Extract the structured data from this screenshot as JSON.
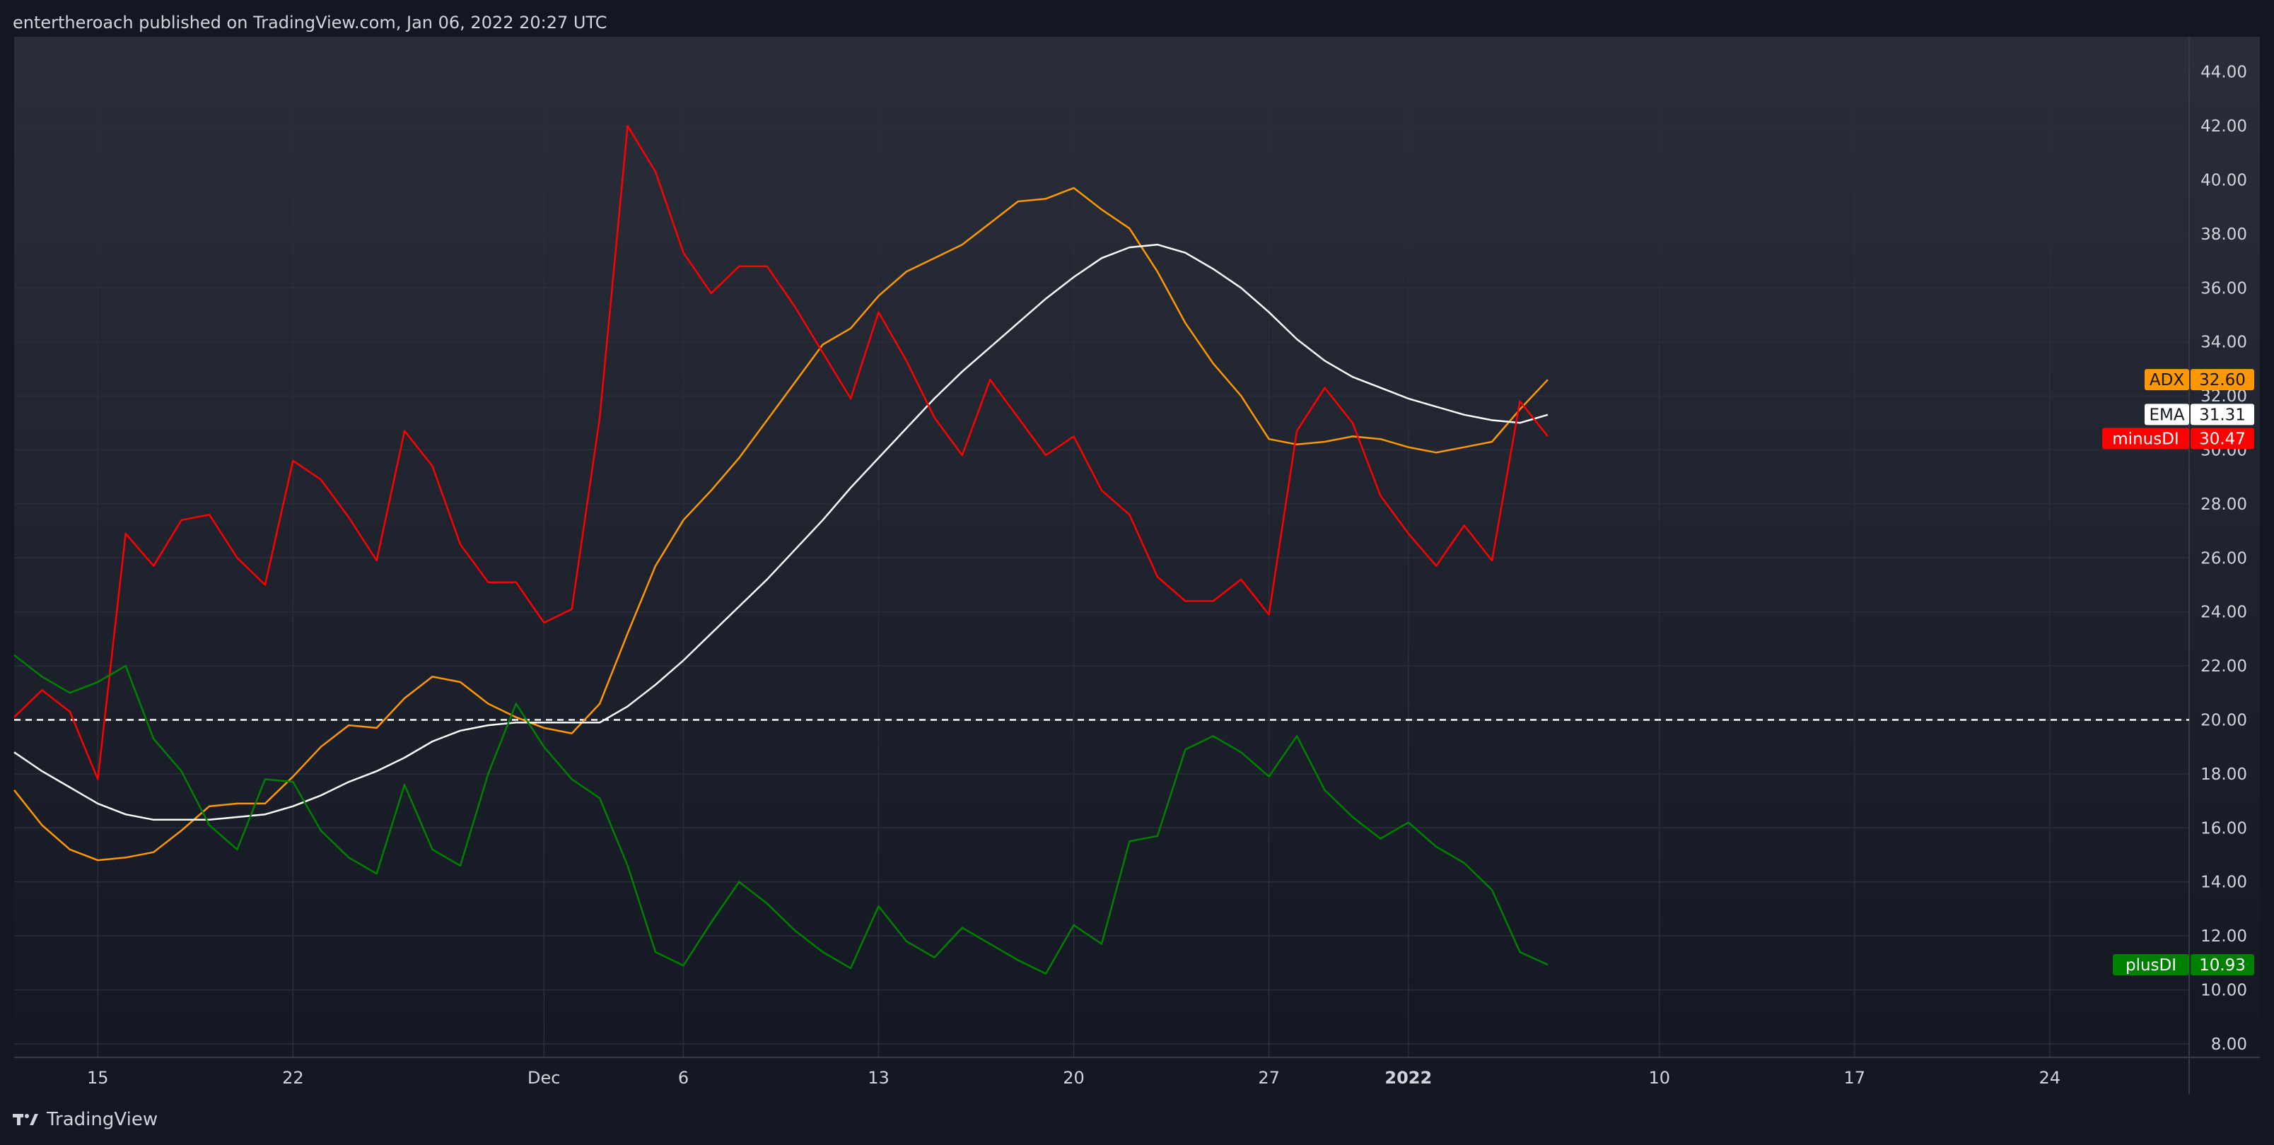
{
  "header": {
    "published_text": "entertheroach published on TradingView.com, Jan 06, 2022 20:27 UTC"
  },
  "footer": {
    "brand_icon": "tradingview-logo-icon",
    "brand_label": "TradingView"
  },
  "colors": {
    "background": "#131722",
    "pane_top": "#2a2e39",
    "pane_bottom": "#131722",
    "grid": "#2a2e39",
    "text": "#d1d4dc",
    "adx": "#ff9800",
    "ema": "#ffffff",
    "minus_di": "#ff0000",
    "plus_di": "#008000"
  },
  "chart_data": {
    "type": "line",
    "title": "",
    "xlabel": "",
    "ylabel": "",
    "ylim": [
      7.5,
      45.3
    ],
    "y_ticks": [
      "8.00",
      "10.00",
      "12.00",
      "14.00",
      "16.00",
      "18.00",
      "20.00",
      "22.00",
      "24.00",
      "26.00",
      "28.00",
      "30.00",
      "32.00",
      "34.00",
      "36.00",
      "38.00",
      "40.00",
      "42.00",
      "44.00"
    ],
    "x_domain": [
      "2021-11-12",
      "2022-01-29"
    ],
    "x_ticks": [
      {
        "label": "15",
        "date": "2021-11-15",
        "bold": false
      },
      {
        "label": "22",
        "date": "2021-11-22",
        "bold": false
      },
      {
        "label": "Dec",
        "date": "2021-12-01",
        "bold": false
      },
      {
        "label": "6",
        "date": "2021-12-06",
        "bold": false
      },
      {
        "label": "13",
        "date": "2021-12-13",
        "bold": false
      },
      {
        "label": "20",
        "date": "2021-12-20",
        "bold": false
      },
      {
        "label": "27",
        "date": "2021-12-27",
        "bold": false
      },
      {
        "label": "2022",
        "date": "2022-01-01",
        "bold": true
      },
      {
        "label": "10",
        "date": "2022-01-10",
        "bold": false
      },
      {
        "label": "17",
        "date": "2022-01-17",
        "bold": false
      },
      {
        "label": "24",
        "date": "2022-01-24",
        "bold": false
      }
    ],
    "hline": {
      "value": 20.0,
      "style": "dashed",
      "color": "#ffffff"
    },
    "grid": true,
    "x": [
      "2021-11-12",
      "2021-11-13",
      "2021-11-14",
      "2021-11-15",
      "2021-11-16",
      "2021-11-17",
      "2021-11-18",
      "2021-11-19",
      "2021-11-20",
      "2021-11-21",
      "2021-11-22",
      "2021-11-23",
      "2021-11-24",
      "2021-11-25",
      "2021-11-26",
      "2021-11-27",
      "2021-11-28",
      "2021-11-29",
      "2021-11-30",
      "2021-12-01",
      "2021-12-02",
      "2021-12-03",
      "2021-12-04",
      "2021-12-05",
      "2021-12-06",
      "2021-12-07",
      "2021-12-08",
      "2021-12-09",
      "2021-12-10",
      "2021-12-11",
      "2021-12-12",
      "2021-12-13",
      "2021-12-14",
      "2021-12-15",
      "2021-12-16",
      "2021-12-17",
      "2021-12-18",
      "2021-12-19",
      "2021-12-20",
      "2021-12-21",
      "2021-12-22",
      "2021-12-23",
      "2021-12-24",
      "2021-12-25",
      "2021-12-26",
      "2021-12-27",
      "2021-12-28",
      "2021-12-29",
      "2021-12-30",
      "2021-12-31",
      "2022-01-01",
      "2022-01-02",
      "2022-01-03",
      "2022-01-04",
      "2022-01-05",
      "2022-01-06"
    ],
    "series": [
      {
        "name": "ADX",
        "color": "#ff9800",
        "last_value": "32.60",
        "values": [
          17.4,
          16.1,
          15.2,
          14.8,
          14.9,
          15.1,
          15.9,
          16.8,
          16.9,
          16.9,
          17.9,
          19.0,
          19.8,
          19.7,
          20.8,
          21.6,
          21.4,
          20.6,
          20.1,
          19.7,
          19.5,
          20.6,
          23.2,
          25.7,
          27.4,
          28.5,
          29.7,
          31.1,
          32.5,
          33.9,
          34.5,
          35.7,
          36.6,
          37.1,
          37.6,
          38.4,
          39.2,
          39.3,
          39.7,
          38.9,
          38.2,
          36.6,
          34.7,
          33.2,
          32.0,
          30.4,
          30.2,
          30.3,
          30.5,
          30.4,
          30.1,
          29.9,
          30.1,
          30.3,
          31.5,
          32.6
        ]
      },
      {
        "name": "EMA",
        "color": "#ffffff",
        "last_value": "31.31",
        "values": [
          18.8,
          18.1,
          17.5,
          16.9,
          16.5,
          16.3,
          16.3,
          16.3,
          16.4,
          16.5,
          16.8,
          17.2,
          17.7,
          18.1,
          18.6,
          19.2,
          19.6,
          19.8,
          19.9,
          19.9,
          19.9,
          19.9,
          20.5,
          21.3,
          22.2,
          23.2,
          24.2,
          25.2,
          26.3,
          27.4,
          28.6,
          29.7,
          30.8,
          31.9,
          32.9,
          33.8,
          34.7,
          35.6,
          36.4,
          37.1,
          37.5,
          37.6,
          37.3,
          36.7,
          36.0,
          35.1,
          34.1,
          33.3,
          32.7,
          32.3,
          31.9,
          31.6,
          31.3,
          31.1,
          31.0,
          31.3
        ]
      },
      {
        "name": "minusDI",
        "color": "#ff0000",
        "last_value": "30.47",
        "values": [
          20.1,
          21.1,
          20.3,
          17.8,
          26.9,
          25.7,
          27.4,
          27.6,
          26.0,
          25.0,
          29.6,
          28.9,
          27.5,
          25.9,
          30.7,
          29.4,
          26.5,
          25.1,
          25.1,
          23.6,
          24.1,
          31.2,
          42.0,
          40.3,
          37.3,
          35.8,
          36.8,
          36.8,
          35.3,
          33.6,
          31.9,
          35.1,
          33.3,
          31.2,
          29.8,
          32.6,
          31.2,
          29.8,
          30.5,
          28.5,
          27.6,
          25.3,
          24.4,
          24.4,
          25.2,
          23.9,
          30.7,
          32.3,
          31.0,
          28.3,
          26.9,
          25.7,
          27.2,
          25.9,
          31.8,
          30.5
        ]
      },
      {
        "name": "plusDI",
        "color": "#008000",
        "last_value": "10.93",
        "values": [
          22.4,
          21.6,
          21.0,
          21.4,
          22.0,
          19.3,
          18.1,
          16.1,
          15.2,
          17.8,
          17.7,
          15.9,
          14.9,
          14.3,
          17.6,
          15.2,
          14.6,
          18.0,
          20.6,
          19.0,
          17.8,
          17.1,
          14.6,
          11.4,
          10.9,
          12.5,
          14.0,
          13.2,
          12.2,
          11.4,
          10.8,
          13.1,
          11.8,
          11.2,
          12.3,
          11.7,
          11.1,
          10.6,
          12.4,
          11.7,
          15.5,
          15.7,
          18.9,
          19.4,
          18.8,
          17.9,
          19.4,
          17.4,
          16.4,
          15.6,
          16.2,
          15.3,
          14.7,
          13.7,
          11.4,
          10.93
        ]
      }
    ]
  }
}
